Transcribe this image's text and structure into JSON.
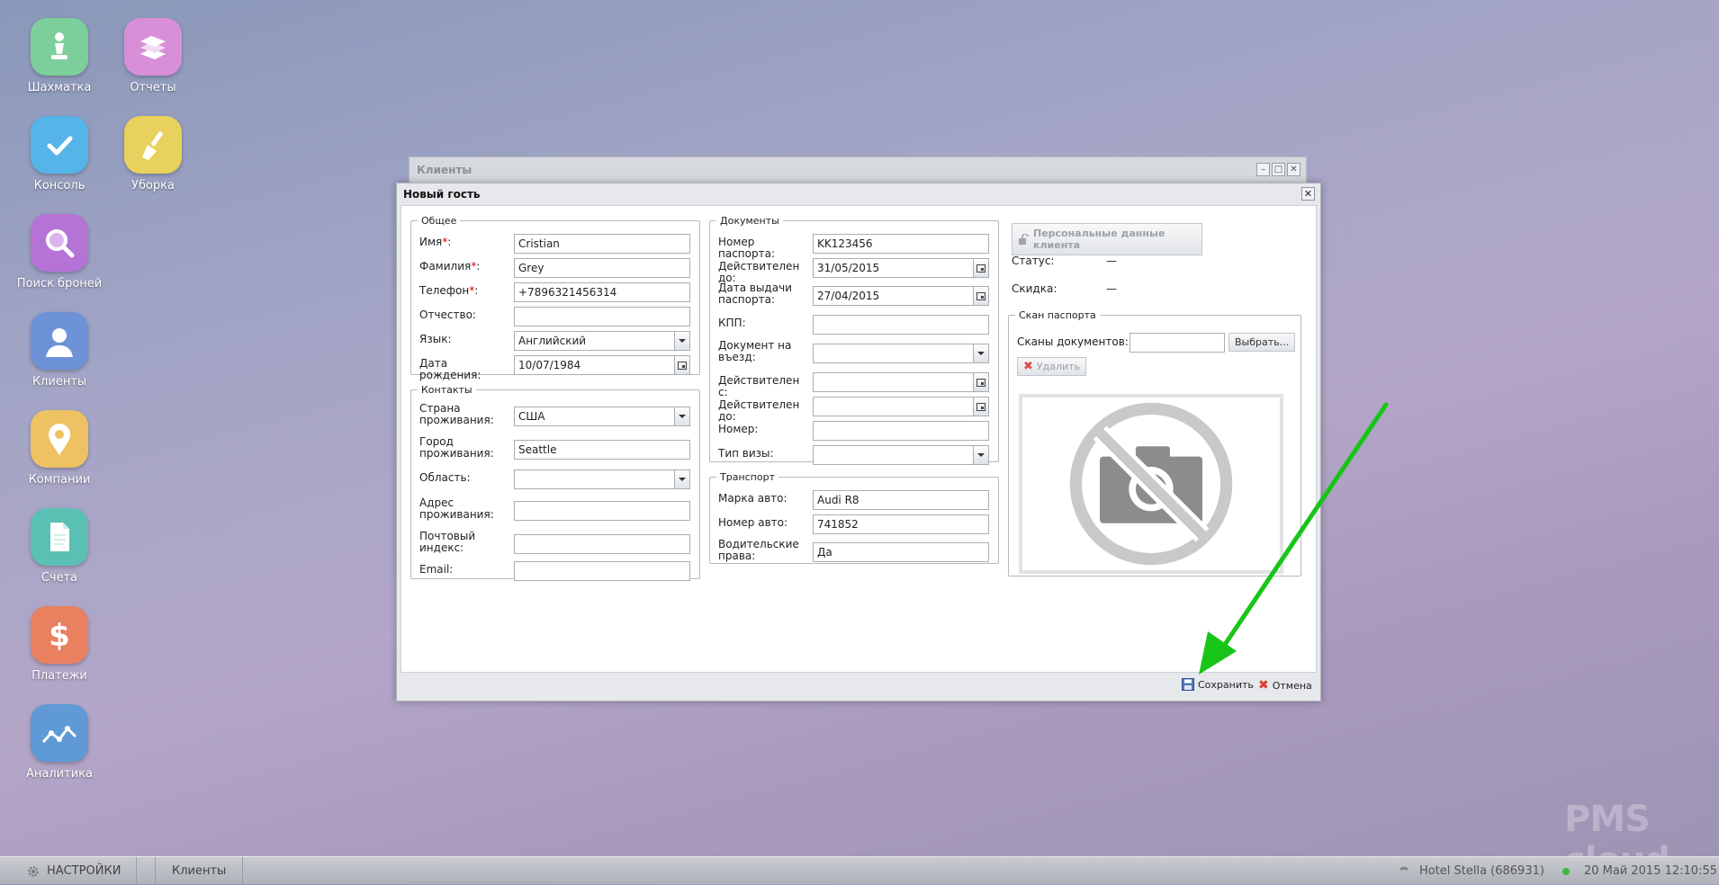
{
  "desktop": {
    "icons": [
      {
        "label": "Шахматка",
        "color": "#7ccf9a"
      },
      {
        "label": "Отчеты",
        "color": "#d88fd8"
      },
      {
        "label": "Консоль",
        "color": "#55b4e8"
      },
      {
        "label": "Уборка",
        "color": "#e8d15c"
      },
      {
        "label": "Поиск броней",
        "color": "#b573d6"
      },
      {
        "label": "Клиенты",
        "color": "#6e92d8"
      },
      {
        "label": "Компании",
        "color": "#eec263"
      },
      {
        "label": "Счета",
        "color": "#5bc0b4"
      },
      {
        "label": "Платежи",
        "color": "#e98060"
      },
      {
        "label": "Аналитика",
        "color": "#5f9ad6"
      }
    ]
  },
  "back_window": {
    "title": "Клиенты"
  },
  "dialog": {
    "title": "Новый гость",
    "general": {
      "legend": "Общее",
      "first_name": {
        "label": "Имя",
        "value": "Cristian"
      },
      "last_name": {
        "label": "Фамилия",
        "value": "Grey"
      },
      "phone": {
        "label": "Телефон",
        "value": "+7896321456314"
      },
      "patronymic": {
        "label": "Отчество:",
        "value": ""
      },
      "language": {
        "label": "Язык:",
        "value": "Английский"
      },
      "birth_date": {
        "label": "Дата рождения:",
        "value": "10/07/1984"
      }
    },
    "required_mark": "*",
    "colon": ":",
    "contacts": {
      "legend": "Контакты",
      "country": {
        "label": "Страна проживания:",
        "value": "США"
      },
      "city": {
        "label": "Город проживания:",
        "value": "Seattle"
      },
      "region": {
        "label": "Область:",
        "value": ""
      },
      "address": {
        "label": "Адрес проживания:",
        "value": ""
      },
      "zip": {
        "label": "Почтовый индекс:",
        "value": ""
      },
      "email": {
        "label": "Email:",
        "value": ""
      }
    },
    "documents": {
      "legend": "Документы",
      "passport_number": {
        "label": "Номер паспорта:",
        "value": "KK123456"
      },
      "valid_until": {
        "label": "Действителен до:",
        "value": "31/05/2015"
      },
      "issue_date": {
        "label": "Дата выдачи паспорта:",
        "value": "27/04/2015"
      },
      "kpp": {
        "label": "КПП:",
        "value": ""
      },
      "entry_doc": {
        "label": "Документ на въезд:",
        "value": ""
      },
      "valid_from": {
        "label": "Действителен с:",
        "value": ""
      },
      "valid_until2": {
        "label": "Действителен до:",
        "value": ""
      },
      "number": {
        "label": "Номер:",
        "value": ""
      },
      "visa_type": {
        "label": "Тип визы:",
        "value": ""
      }
    },
    "transport": {
      "legend": "Транспорт",
      "car_make": {
        "label": "Марка авто:",
        "value": "Audi R8"
      },
      "car_number": {
        "label": "Номер авто:",
        "value": "741852"
      },
      "license": {
        "label": "Водительские права:",
        "value": "Да"
      }
    },
    "personal_data_button": "Персональные данные клиента",
    "status": {
      "label": "Статус:",
      "value": "—"
    },
    "discount": {
      "label": "Скидка:",
      "value": "—"
    },
    "scan": {
      "legend": "Скан паспорта",
      "label": "Сканы документов:",
      "value": "",
      "choose_button": "Выбрать...",
      "delete_button": "Удалить"
    },
    "save_button": "Сохранить",
    "cancel_button": "Отмена"
  },
  "taskbar": {
    "settings": "НАСТРОЙКИ",
    "task": "Клиенты",
    "hotel": "Hotel Stella (686931)",
    "datetime": "20 Май 2015 12:10:55"
  },
  "watermark": "PMS cloud",
  "colors": {
    "arrow": "#19c419",
    "required": "#d40000",
    "status_dot": "#3cb93c"
  }
}
